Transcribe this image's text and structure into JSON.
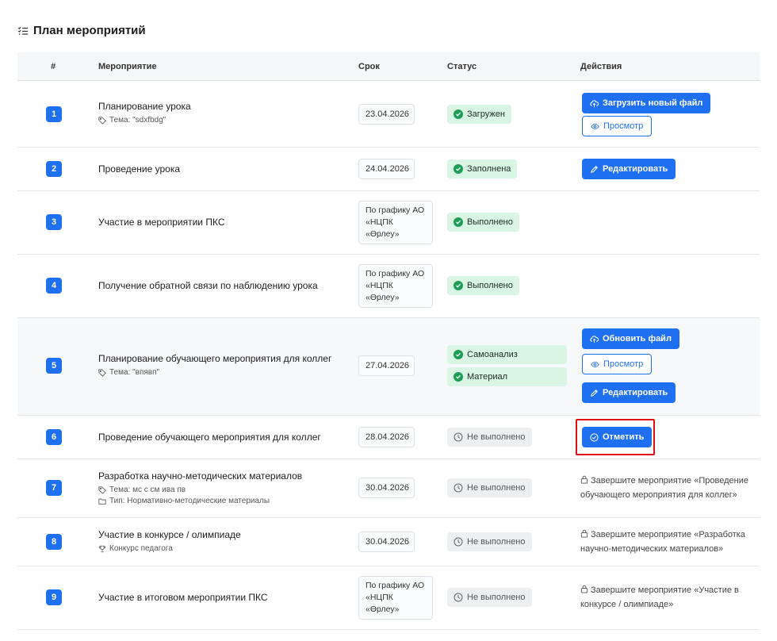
{
  "page": {
    "title": "План мероприятий"
  },
  "table": {
    "headers": [
      "#",
      "Мероприятие",
      "Срок",
      "Статус",
      "Действия"
    ]
  },
  "rows": [
    {
      "num": "1",
      "title": "Планирование урока",
      "meta": [
        {
          "icon": "tag-icon",
          "text": "Тема: \"sdxfbdg\""
        }
      ],
      "date": "23.04.2026",
      "status": [
        {
          "type": "ok",
          "text": "Загружен"
        }
      ],
      "buttons": [
        {
          "kind": "primary",
          "icon": "cloud-upload-icon",
          "label": "Загрузить новый файл"
        },
        {
          "kind": "outline",
          "icon": "eye-icon",
          "label": "Просмотр"
        }
      ]
    },
    {
      "num": "2",
      "title": "Проведение урока",
      "meta": [],
      "date": "24.04.2026",
      "status": [
        {
          "type": "ok",
          "text": "Заполнена"
        }
      ],
      "buttons": [
        {
          "kind": "primary",
          "icon": "pencil-icon",
          "label": "Редактировать"
        }
      ]
    },
    {
      "num": "3",
      "title": "Участие в мероприятии ПКС",
      "meta": [],
      "date": "По графику АО «НЦПК «Өрлеу»",
      "status": [
        {
          "type": "ok",
          "text": "Выполнено"
        }
      ],
      "buttons": []
    },
    {
      "num": "4",
      "title": "Получение обратной связи по наблюдению урока",
      "meta": [],
      "date": "По графику АО «НЦПК «Өрлеу»",
      "status": [
        {
          "type": "ok",
          "text": "Выполнено"
        }
      ],
      "buttons": []
    },
    {
      "num": "5",
      "title": "Планирование обучающего мероприятия для коллег",
      "meta": [
        {
          "icon": "tag-icon",
          "text": "Тема: \"впявп\""
        }
      ],
      "date": "27.04.2026",
      "status": [
        {
          "type": "ok",
          "text": "Самоанализ"
        },
        {
          "type": "ok",
          "text": "Материал"
        }
      ],
      "buttons": [
        {
          "kind": "primary",
          "icon": "cloud-upload-icon",
          "label": "Обновить файл"
        },
        {
          "kind": "outline",
          "icon": "eye-icon",
          "label": "Просмотр"
        },
        {
          "kind": "primary",
          "icon": "pencil-icon",
          "label": "Редактировать"
        }
      ]
    },
    {
      "num": "6",
      "title": "Проведение обучающего мероприятия для коллег",
      "meta": [],
      "date": "28.04.2026",
      "status": [
        {
          "type": "no",
          "text": "Не выполнено"
        }
      ],
      "buttons": [
        {
          "kind": "primary",
          "icon": "check-circle-icon",
          "label": "Отметить"
        }
      ]
    },
    {
      "num": "7",
      "title": "Разработка научно-методических материалов",
      "meta": [
        {
          "icon": "tag-icon",
          "text": "Тема: мс с см ива пв"
        },
        {
          "icon": "folder-icon",
          "text": "Тип: Нормативно-методические материалы"
        }
      ],
      "date": "30.04.2026",
      "status": [
        {
          "type": "no",
          "text": "Не выполнено"
        }
      ],
      "note": "Завершите мероприятие «Проведение обучающего мероприятия для коллег»"
    },
    {
      "num": "8",
      "title": "Участие в конкурсе / олимпиаде",
      "meta": [
        {
          "icon": "trophy-icon",
          "text": "Конкурс педагога"
        }
      ],
      "date": "30.04.2026",
      "status": [
        {
          "type": "no",
          "text": "Не выполнено"
        }
      ],
      "note": "Завершите мероприятие «Разработка научно-методических материалов»"
    },
    {
      "num": "9",
      "title": "Участие в итоговом мероприятии ПКС",
      "meta": [],
      "date": "По графику АО «НЦПК «Өрлеу»",
      "status": [
        {
          "type": "no",
          "text": "Не выполнено"
        }
      ],
      "note": "Завершите мероприятие «Участие в конкурсе / олимпиаде»"
    }
  ],
  "colors": {
    "primary": "#1f70f0",
    "success_bg": "#d8f6e3",
    "success_icon": "#1e9e55",
    "neutral_bg": "#eeeff1",
    "highlight": "#e01010"
  }
}
